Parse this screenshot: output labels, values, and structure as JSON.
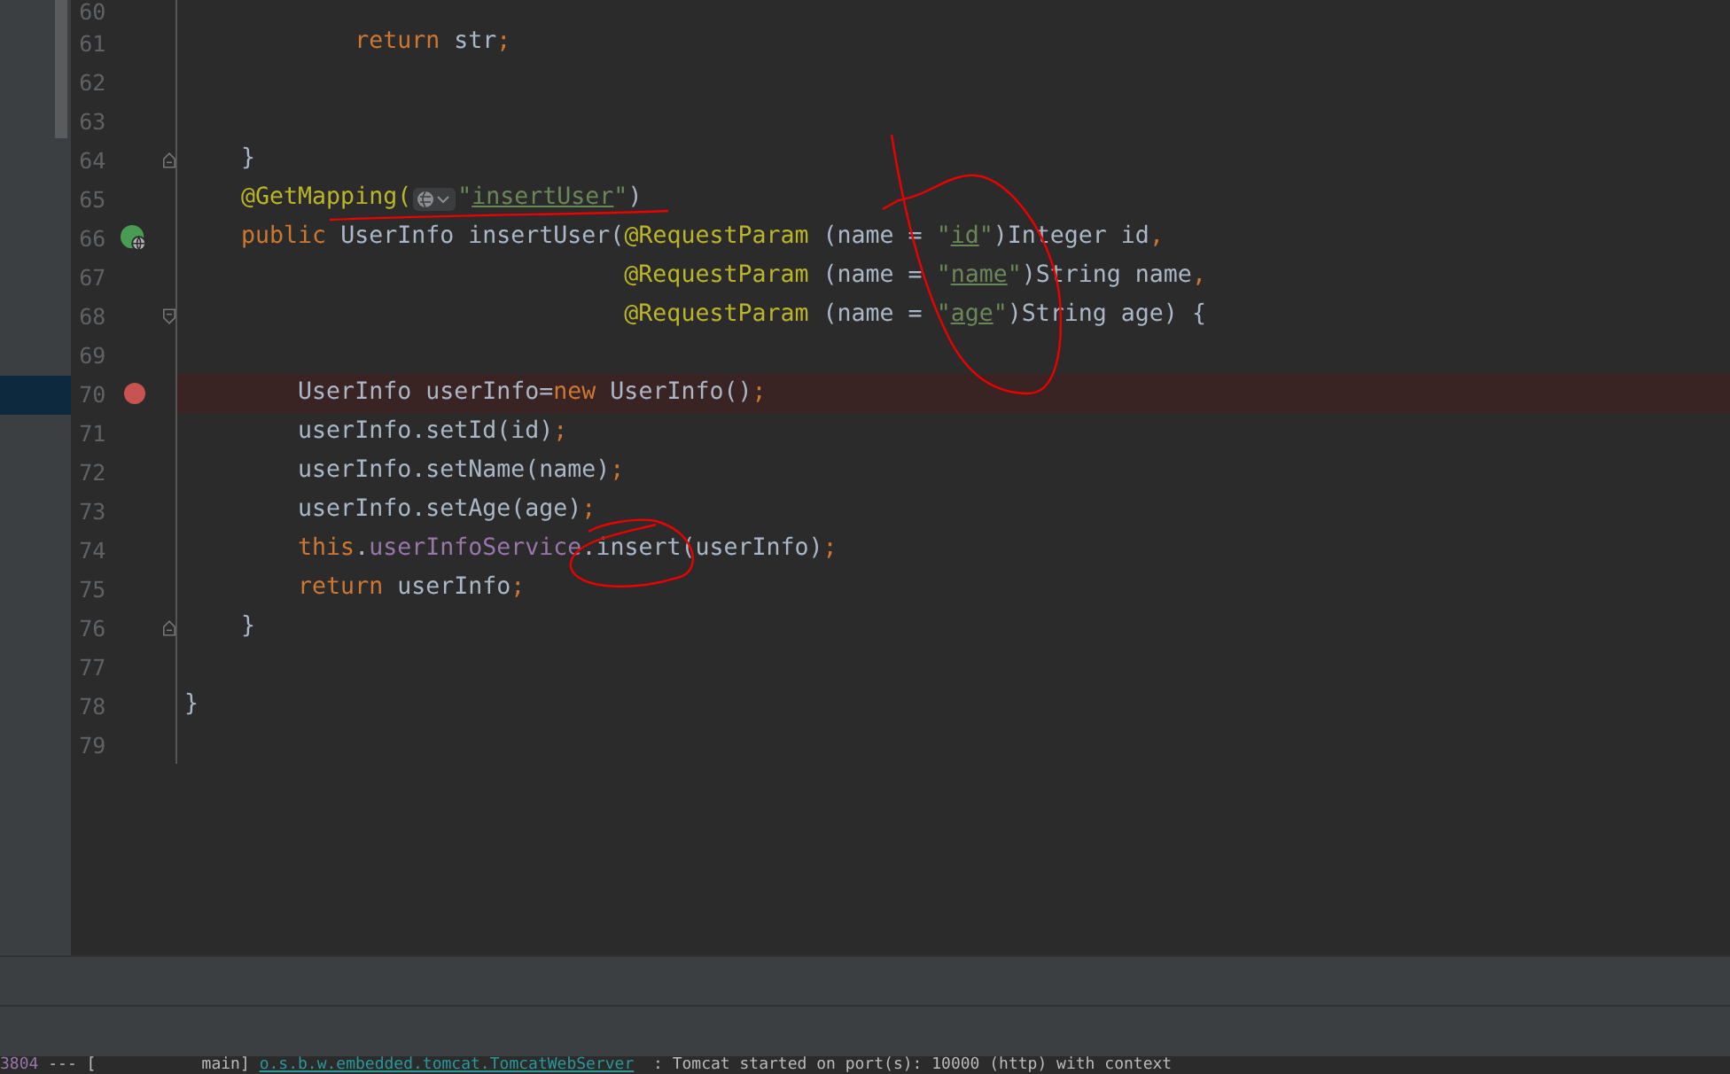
{
  "editor": {
    "lines": [
      {
        "number": "60"
      },
      {
        "number": "61",
        "tokens": [
          {
            "text": "            return",
            "kind": "keyword"
          },
          {
            "text": " str",
            "kind": "plain"
          },
          {
            "text": ";",
            "kind": "keyword"
          }
        ]
      },
      {
        "number": "62"
      },
      {
        "number": "63"
      },
      {
        "number": "64",
        "fold_end": true,
        "tokens": [
          {
            "text": "    }",
            "kind": "plain"
          }
        ]
      },
      {
        "number": "65",
        "tokens": [
          {
            "text": "    @GetMapping(",
            "kind": "annotation"
          },
          {
            "kind": "url_hint"
          },
          {
            "text": "\"",
            "kind": "string"
          },
          {
            "text": "insertUser",
            "kind": "string_ref"
          },
          {
            "text": "\"",
            "kind": "string"
          },
          {
            "text": ")",
            "kind": "plain"
          }
        ]
      },
      {
        "number": "66",
        "endpoint": true,
        "tokens": [
          {
            "text": "    public",
            "kind": "keyword"
          },
          {
            "text": " UserInfo insertUser(",
            "kind": "plain"
          },
          {
            "text": "@RequestParam",
            "kind": "annotation"
          },
          {
            "text": " (name = ",
            "kind": "plain"
          },
          {
            "text": "\"",
            "kind": "string"
          },
          {
            "text": "id",
            "kind": "string_ref"
          },
          {
            "text": "\"",
            "kind": "string"
          },
          {
            "text": ")Integer id",
            "kind": "plain"
          },
          {
            "text": ",",
            "kind": "keyword"
          }
        ]
      },
      {
        "number": "67",
        "tokens": [
          {
            "text": "                               @RequestParam",
            "kind": "annotation"
          },
          {
            "text": " (name = ",
            "kind": "plain"
          },
          {
            "text": "\"",
            "kind": "string"
          },
          {
            "text": "name",
            "kind": "string_ref"
          },
          {
            "text": "\"",
            "kind": "string"
          },
          {
            "text": ")String name",
            "kind": "plain"
          },
          {
            "text": ",",
            "kind": "keyword"
          }
        ]
      },
      {
        "number": "68",
        "fold_start": true,
        "tokens": [
          {
            "text": "                               @RequestParam",
            "kind": "annotation"
          },
          {
            "text": " (name = ",
            "kind": "plain"
          },
          {
            "text": "\"",
            "kind": "string"
          },
          {
            "text": "age",
            "kind": "string_ref"
          },
          {
            "text": "\"",
            "kind": "string"
          },
          {
            "text": ")String age) {",
            "kind": "plain"
          }
        ]
      },
      {
        "number": "69"
      },
      {
        "number": "70",
        "breakpoint": true,
        "tokens": [
          {
            "text": "        UserInfo userInfo=",
            "kind": "plain"
          },
          {
            "text": "new",
            "kind": "keyword"
          },
          {
            "text": " UserInfo()",
            "kind": "plain"
          },
          {
            "text": ";",
            "kind": "keyword"
          }
        ]
      },
      {
        "number": "71",
        "tokens": [
          {
            "text": "        userInfo.setId(id)",
            "kind": "plain"
          },
          {
            "text": ";",
            "kind": "keyword"
          }
        ]
      },
      {
        "number": "72",
        "tokens": [
          {
            "text": "        userInfo.setName(name)",
            "kind": "plain"
          },
          {
            "text": ";",
            "kind": "keyword"
          }
        ]
      },
      {
        "number": "73",
        "tokens": [
          {
            "text": "        userInfo.setAge(age)",
            "kind": "plain"
          },
          {
            "text": ";",
            "kind": "keyword"
          }
        ]
      },
      {
        "number": "74",
        "tokens": [
          {
            "text": "        this",
            "kind": "keyword"
          },
          {
            "text": ".",
            "kind": "plain"
          },
          {
            "text": "userInfoService",
            "kind": "field"
          },
          {
            "text": ".insert(userInfo)",
            "kind": "plain"
          },
          {
            "text": ";",
            "kind": "keyword"
          }
        ]
      },
      {
        "number": "75",
        "tokens": [
          {
            "text": "        return",
            "kind": "keyword"
          },
          {
            "text": " userInfo",
            "kind": "plain"
          },
          {
            "text": ";",
            "kind": "keyword"
          }
        ]
      },
      {
        "number": "76",
        "fold_end": true,
        "tokens": [
          {
            "text": "    }",
            "kind": "plain"
          }
        ]
      },
      {
        "number": "77"
      },
      {
        "number": "78",
        "tokens": [
          {
            "text": "}",
            "kind": "plain"
          }
        ]
      },
      {
        "number": "79"
      }
    ]
  },
  "console": {
    "tokens": [
      {
        "text": "3804",
        "kind": "pid"
      },
      {
        "text": " --- [           main] ",
        "kind": "plain"
      },
      {
        "text": "o.s.b.w.embedded.tomcat.TomcatWebServer",
        "kind": "logger"
      },
      {
        "text": "  : Tomcat started on port(s): 10000 (http) with context",
        "kind": "plain"
      }
    ]
  }
}
